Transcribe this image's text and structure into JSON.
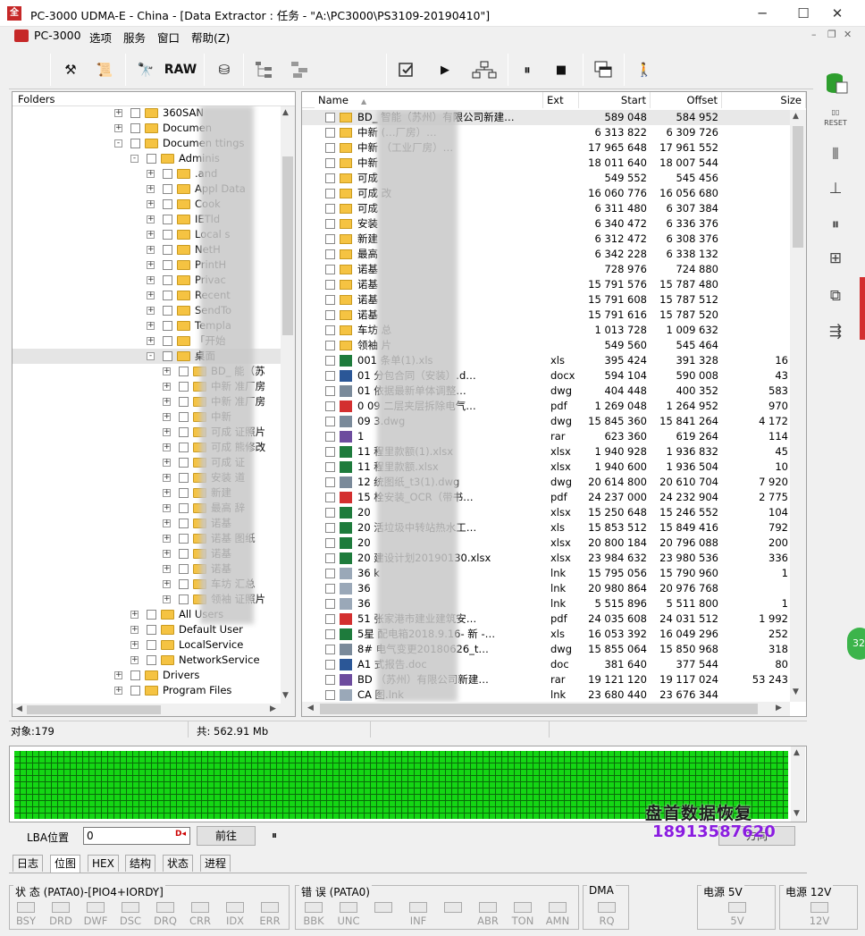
{
  "window": {
    "title": "PC-3000 UDMA-E - China - [Data Extractor : 任务 - \"A:\\PC3000\\PS3109-20190410\"]",
    "minimize": "─",
    "maximize": "☐",
    "close": "✕",
    "inner_min": "–",
    "inner_restore": "❐",
    "inner_close": "✕"
  },
  "menu": {
    "app": "PC-3000",
    "options": "选项",
    "service": "服务",
    "window": "窗口",
    "help": "帮助(Z)"
  },
  "toolbar": {
    "raw": "RAW",
    "tools_icon": "⚒",
    "scroll_icon": "📜",
    "binoculars_icon": "🔭",
    "disk_icon": "⛁",
    "play_icon": "▶",
    "pause_icon": "⏸",
    "stop_icon": "■",
    "exit_icon": "🚶"
  },
  "tree": {
    "header": "Folders",
    "rows": [
      {
        "label": "360SAN",
        "lvl": 1,
        "exp": "+"
      },
      {
        "label": "Documen",
        "lvl": 1,
        "exp": "+"
      },
      {
        "label": "Documen   ttings",
        "lvl": 1,
        "exp": "-"
      },
      {
        "label": "Adminis",
        "lvl": 2,
        "exp": "-"
      },
      {
        "label": ".and",
        "lvl": 3,
        "exp": "+"
      },
      {
        "label": "Appl       Data",
        "lvl": 3,
        "exp": "+"
      },
      {
        "label": "Cook",
        "lvl": 3,
        "exp": "+"
      },
      {
        "label": "IETld",
        "lvl": 3,
        "exp": "+"
      },
      {
        "label": "Local       s",
        "lvl": 3,
        "exp": "+"
      },
      {
        "label": "NetH",
        "lvl": 3,
        "exp": "+"
      },
      {
        "label": "PrintH",
        "lvl": 3,
        "exp": "+"
      },
      {
        "label": "Privac",
        "lvl": 3,
        "exp": "+"
      },
      {
        "label": "Recent",
        "lvl": 3,
        "exp": "+"
      },
      {
        "label": "SendTo",
        "lvl": 3,
        "exp": "+"
      },
      {
        "label": "Templa",
        "lvl": 3,
        "exp": "+"
      },
      {
        "label": "「开始",
        "lvl": 3,
        "exp": "+"
      },
      {
        "label": "桌面",
        "lvl": 3,
        "exp": "-"
      },
      {
        "label": "BD_       能（苏",
        "lvl": 4,
        "exp": "+"
      },
      {
        "label": "中新       准厂房",
        "lvl": 4,
        "exp": "+"
      },
      {
        "label": "中新       准厂房",
        "lvl": 4,
        "exp": "+"
      },
      {
        "label": "中新",
        "lvl": 4,
        "exp": "+"
      },
      {
        "label": "可成       证照片",
        "lvl": 4,
        "exp": "+"
      },
      {
        "label": "可成       熊修改",
        "lvl": 4,
        "exp": "+"
      },
      {
        "label": "可成       证",
        "lvl": 4,
        "exp": "+"
      },
      {
        "label": "安装       道",
        "lvl": 4,
        "exp": "+"
      },
      {
        "label": "新建",
        "lvl": 4,
        "exp": "+"
      },
      {
        "label": "最高       辞",
        "lvl": 4,
        "exp": "+"
      },
      {
        "label": "诺基",
        "lvl": 4,
        "exp": "+"
      },
      {
        "label": "诺基       图纸",
        "lvl": 4,
        "exp": "+"
      },
      {
        "label": "诺基",
        "lvl": 4,
        "exp": "+"
      },
      {
        "label": "诺基",
        "lvl": 4,
        "exp": "+"
      },
      {
        "label": "车坊       汇总",
        "lvl": 4,
        "exp": "+"
      },
      {
        "label": "领袖       证照片",
        "lvl": 4,
        "exp": "+"
      },
      {
        "label": "All Users",
        "lvl": 2,
        "exp": "+"
      },
      {
        "label": "Default User",
        "lvl": 2,
        "exp": "+"
      },
      {
        "label": "LocalService",
        "lvl": 2,
        "exp": "+"
      },
      {
        "label": "NetworkService",
        "lvl": 2,
        "exp": "+"
      },
      {
        "label": "Drivers",
        "lvl": 1,
        "exp": "+"
      },
      {
        "label": "Program Files",
        "lvl": 1,
        "exp": "+"
      }
    ]
  },
  "files": {
    "headers": {
      "name": "Name",
      "ext": "Ext",
      "start": "Start",
      "offset": "Offset",
      "size": "Size"
    },
    "rows": [
      {
        "name": "BD_     智能（苏州）有限公司新建…",
        "ext": "",
        "start": "589 048",
        "offset": "584 952",
        "size": "",
        "icon": "folder"
      },
      {
        "name": "中新       (…厂房）…",
        "ext": "",
        "start": "6 313 822",
        "offset": "6 309 726",
        "size": "",
        "icon": "folder"
      },
      {
        "name": "中新       （工业厂房）…",
        "ext": "",
        "start": "17 965 648",
        "offset": "17 961 552",
        "size": "",
        "icon": "folder"
      },
      {
        "name": "中新",
        "ext": "",
        "start": "18 011 640",
        "offset": "18 007 544",
        "size": "",
        "icon": "folder"
      },
      {
        "name": "可成",
        "ext": "",
        "start": "549 552",
        "offset": "545 456",
        "size": "",
        "icon": "folder"
      },
      {
        "name": "可成        改",
        "ext": "",
        "start": "16 060 776",
        "offset": "16 056 680",
        "size": "",
        "icon": "folder"
      },
      {
        "name": "可成",
        "ext": "",
        "start": "6 311 480",
        "offset": "6 307 384",
        "size": "",
        "icon": "folder"
      },
      {
        "name": "安装",
        "ext": "",
        "start": "6 340 472",
        "offset": "6 336 376",
        "size": "",
        "icon": "folder"
      },
      {
        "name": "新建",
        "ext": "",
        "start": "6 312 472",
        "offset": "6 308 376",
        "size": "",
        "icon": "folder"
      },
      {
        "name": "最高",
        "ext": "",
        "start": "6 342 228",
        "offset": "6 338 132",
        "size": "",
        "icon": "folder"
      },
      {
        "name": "诺基",
        "ext": "",
        "start": "728 976",
        "offset": "724 880",
        "size": "",
        "icon": "folder"
      },
      {
        "name": "诺基",
        "ext": "",
        "start": "15 791 576",
        "offset": "15 787 480",
        "size": "",
        "icon": "folder"
      },
      {
        "name": "诺基",
        "ext": "",
        "start": "15 791 608",
        "offset": "15 787 512",
        "size": "",
        "icon": "folder"
      },
      {
        "name": "诺基",
        "ext": "",
        "start": "15 791 616",
        "offset": "15 787 520",
        "size": "",
        "icon": "folder"
      },
      {
        "name": "车坊        总",
        "ext": "",
        "start": "1 013 728",
        "offset": "1 009 632",
        "size": "",
        "icon": "folder"
      },
      {
        "name": "领袖        片",
        "ext": "",
        "start": "549 560",
        "offset": "545 464",
        "size": "",
        "icon": "folder"
      },
      {
        "name": "001       条单(1).xls",
        "ext": "xls",
        "start": "395 424",
        "offset": "391 328",
        "size": "16",
        "icon": "excel"
      },
      {
        "name": "01       分包合同（安装）.d…",
        "ext": "docx",
        "start": "594 104",
        "offset": "590 008",
        "size": "43",
        "icon": "word"
      },
      {
        "name": "01       依据最新单体调整…",
        "ext": "dwg",
        "start": "404 448",
        "offset": "400 352",
        "size": "583",
        "icon": "dwg"
      },
      {
        "name": "0       09 二层夹层拆除电气…",
        "ext": "pdf",
        "start": "1 269 048",
        "offset": "1 264 952",
        "size": "970",
        "icon": "pdf"
      },
      {
        "name": "09       3.dwg",
        "ext": "dwg",
        "start": "15 845 360",
        "offset": "15 841 264",
        "size": "4 172",
        "icon": "dwg"
      },
      {
        "name": "1",
        "ext": "rar",
        "start": "623 360",
        "offset": "619 264",
        "size": "114",
        "icon": "rar"
      },
      {
        "name": "11       程里款额(1).xlsx",
        "ext": "xlsx",
        "start": "1 940 928",
        "offset": "1 936 832",
        "size": "45",
        "icon": "excel"
      },
      {
        "name": "11       程里款额.xlsx",
        "ext": "xlsx",
        "start": "1 940 600",
        "offset": "1 936 504",
        "size": "10",
        "icon": "excel"
      },
      {
        "name": "12       统图纸_t3(1).dwg",
        "ext": "dwg",
        "start": "20 614 800",
        "offset": "20 610 704",
        "size": "7 920",
        "icon": "dwg"
      },
      {
        "name": "15       栓安装_OCR（带书…",
        "ext": "pdf",
        "start": "24 237 000",
        "offset": "24 232 904",
        "size": "2 775",
        "icon": "pdf"
      },
      {
        "name": "20",
        "ext": "xlsx",
        "start": "15 250 648",
        "offset": "15 246 552",
        "size": "104",
        "icon": "excel"
      },
      {
        "name": "20       活垃圾中转站热水工…",
        "ext": "xls",
        "start": "15 853 512",
        "offset": "15 849 416",
        "size": "792",
        "icon": "excel"
      },
      {
        "name": "20",
        "ext": "xlsx",
        "start": "20 800 184",
        "offset": "20 796 088",
        "size": "200",
        "icon": "excel"
      },
      {
        "name": "20       建设计划20190130.xlsx",
        "ext": "xlsx",
        "start": "23 984 632",
        "offset": "23 980 536",
        "size": "336",
        "icon": "excel"
      },
      {
        "name": "36       k",
        "ext": "lnk",
        "start": "15 795 056",
        "offset": "15 790 960",
        "size": "1",
        "icon": "lnk"
      },
      {
        "name": "36",
        "ext": "lnk",
        "start": "20 980 864",
        "offset": "20 976 768",
        "size": "",
        "icon": "lnk"
      },
      {
        "name": "36",
        "ext": "lnk",
        "start": "5 515 896",
        "offset": "5 511 800",
        "size": "1",
        "icon": "lnk"
      },
      {
        "name": "51       张家港市建业建筑安…",
        "ext": "pdf",
        "start": "24 035 608",
        "offset": "24 031 512",
        "size": "1 992",
        "icon": "pdf"
      },
      {
        "name": "5星       配电箱2018.9.16- 新 -…",
        "ext": "xls",
        "start": "16 053 392",
        "offset": "16 049 296",
        "size": "252",
        "icon": "excel"
      },
      {
        "name": "8#       电气变更20180626_t…",
        "ext": "dwg",
        "start": "15 855 064",
        "offset": "15 850 968",
        "size": "318",
        "icon": "dwg"
      },
      {
        "name": "A1       式报告.doc",
        "ext": "doc",
        "start": "381 640",
        "offset": "377 544",
        "size": "80",
        "icon": "word"
      },
      {
        "name": "BD       （苏州）有限公司新建…",
        "ext": "rar",
        "start": "19 121 120",
        "offset": "19 117 024",
        "size": "53 243",
        "icon": "rar"
      },
      {
        "name": "CA       图.lnk",
        "ext": "lnk",
        "start": "23 680 440",
        "offset": "23 676 344",
        "size": "",
        "icon": "lnk"
      }
    ]
  },
  "status": {
    "objects": "对象:179",
    "total": "共: 562.91 Mb"
  },
  "lba": {
    "label": "LBA位置",
    "value": "0",
    "go": "前往",
    "pause": "⏸",
    "dir_btn": "方向"
  },
  "tabs": [
    "日志",
    "位图",
    "HEX",
    "结构",
    "状态",
    "进程"
  ],
  "status_bar": {
    "state_title": "状 态 (PATA0)-[PIO4+IORDY]",
    "state_leds": [
      "BSY",
      "DRD",
      "DWF",
      "DSC",
      "DRQ",
      "CRR",
      "IDX",
      "ERR"
    ],
    "error_title": "错 误 (PATA0)",
    "error_leds": [
      "BBK",
      "UNC",
      "",
      "INF",
      "",
      "ABR",
      "TON",
      "AMN"
    ],
    "dma_title": "DMA",
    "dma_leds": [
      "RQ"
    ],
    "p5_title": "电源 5V",
    "p5_leds": [
      "5V"
    ],
    "p12_title": "电源 12V",
    "p12_leds": [
      "12V"
    ]
  },
  "watermark": {
    "line1": "盘首数据恢复",
    "line2": "18913587620"
  },
  "badge": "32",
  "colors": {
    "accent_green": "#14d614",
    "title_red": "#c62828",
    "watermark_purple": "#8a1ce0"
  }
}
